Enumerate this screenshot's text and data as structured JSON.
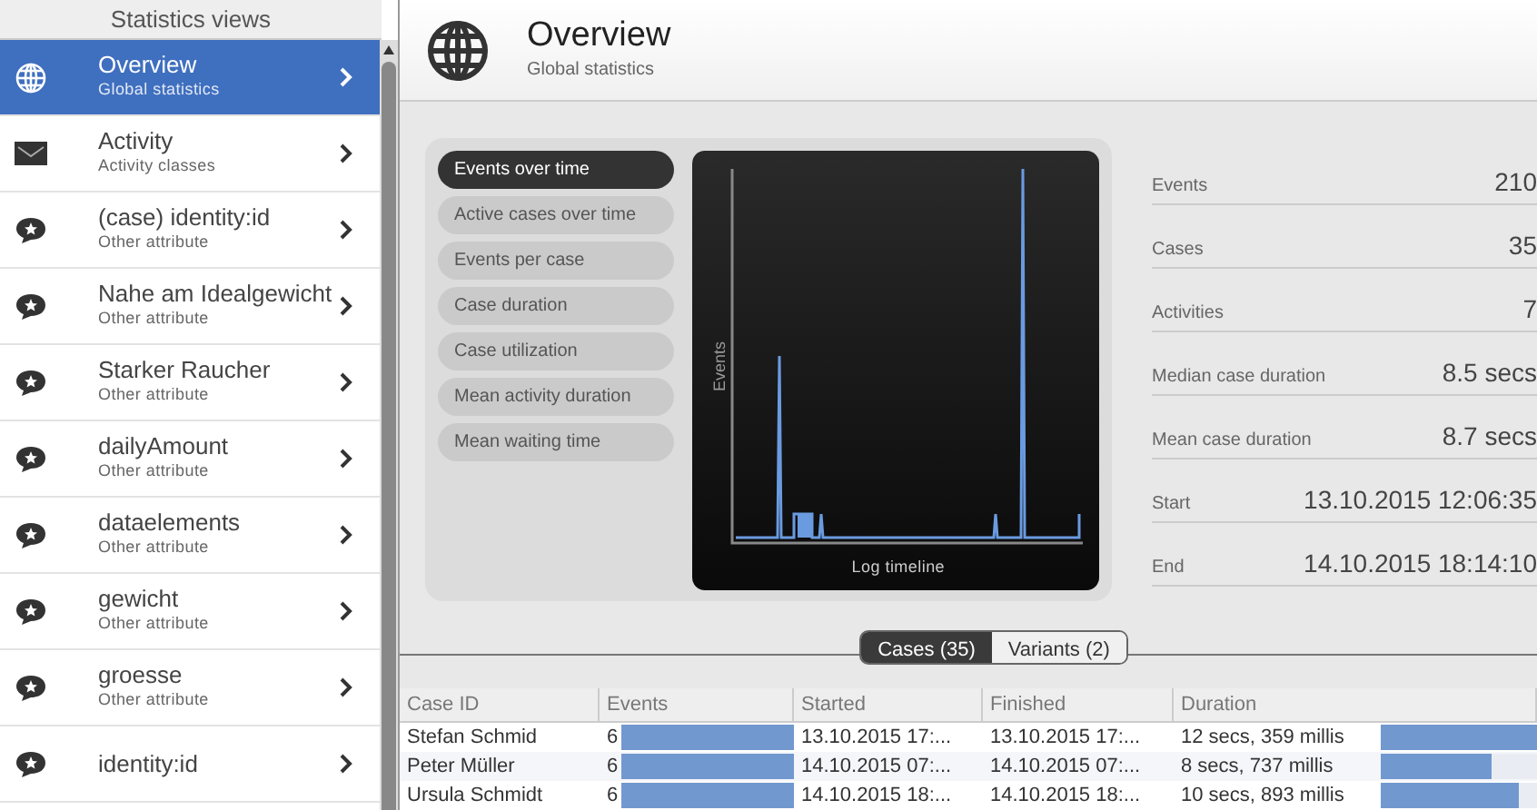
{
  "sidebar": {
    "title": "Statistics views",
    "items": [
      {
        "kind": "globe",
        "label": "Overview",
        "sublabel": "Global statistics",
        "selected": true
      },
      {
        "kind": "envelope",
        "label": "Activity",
        "sublabel": "Activity classes",
        "selected": false
      },
      {
        "kind": "attribute",
        "label": "(case) identity:id",
        "sublabel": "Other attribute",
        "selected": false
      },
      {
        "kind": "attribute",
        "label": "Nahe am Idealgewicht",
        "sublabel": "Other attribute",
        "selected": false
      },
      {
        "kind": "attribute",
        "label": "Starker Raucher",
        "sublabel": "Other attribute",
        "selected": false
      },
      {
        "kind": "attribute",
        "label": "dailyAmount",
        "sublabel": "Other attribute",
        "selected": false
      },
      {
        "kind": "attribute",
        "label": "dataelements",
        "sublabel": "Other attribute",
        "selected": false
      },
      {
        "kind": "attribute",
        "label": "gewicht",
        "sublabel": "Other attribute",
        "selected": false
      },
      {
        "kind": "attribute",
        "label": "groesse",
        "sublabel": "Other attribute",
        "selected": false
      },
      {
        "kind": "attribute",
        "label": "identity:id",
        "selected": false
      }
    ]
  },
  "header": {
    "title": "Overview",
    "subtitle": "Global statistics"
  },
  "chart_views": [
    {
      "label": "Events over time",
      "selected": true
    },
    {
      "label": "Active cases over time",
      "selected": false
    },
    {
      "label": "Events per case",
      "selected": false
    },
    {
      "label": "Case duration",
      "selected": false
    },
    {
      "label": "Case utilization",
      "selected": false
    },
    {
      "label": "Mean activity duration",
      "selected": false
    },
    {
      "label": "Mean waiting time",
      "selected": false
    }
  ],
  "chart": {
    "ylabel": "Events",
    "xlabel": "Log timeline"
  },
  "stats": [
    {
      "label": "Events",
      "value": "210"
    },
    {
      "label": "Cases",
      "value": "35"
    },
    {
      "label": "Activities",
      "value": "7"
    },
    {
      "label": "Median case duration",
      "value": "8.5 secs"
    },
    {
      "label": "Mean case duration",
      "value": "8.7 secs"
    },
    {
      "label": "Start",
      "value": "13.10.2015 12:06:35"
    },
    {
      "label": "End",
      "value": "14.10.2015 18:14:10"
    }
  ],
  "tabs": [
    {
      "label": "Cases (35)",
      "selected": true
    },
    {
      "label": "Variants (2)",
      "selected": false
    }
  ],
  "table": {
    "columns": [
      "Case ID",
      "Events",
      "Started",
      "Finished",
      "Duration"
    ],
    "rows": [
      {
        "case_id": "Stefan Schmid",
        "events": "6",
        "events_bar": {
          "level": 1
        },
        "started": "13.10.2015 17:...",
        "finished": "13.10.2015 17:...",
        "duration": "12 secs, 359 millis",
        "duration_bar": {
          "level": 1
        }
      },
      {
        "case_id": "Peter Müller",
        "events": "6",
        "events_bar": {
          "level": 1
        },
        "started": "14.10.2015 07:...",
        "finished": "14.10.2015 07:...",
        "duration": "8 secs, 737 millis",
        "duration_bar": {
          "level": 0.71
        }
      },
      {
        "case_id": "Ursula Schmidt",
        "events": "6",
        "events_bar": {
          "level": 1
        },
        "started": "14.10.2015 18:...",
        "finished": "14.10.2015 18:...",
        "duration": "10 secs, 893 millis",
        "duration_bar": {
          "level": 0.88
        }
      }
    ]
  }
}
